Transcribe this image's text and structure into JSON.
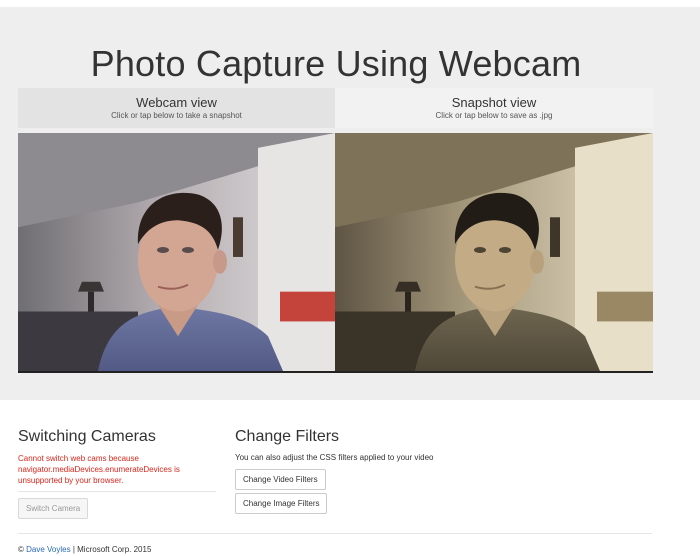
{
  "page": {
    "title": "Photo Capture Using Webcam"
  },
  "webcam": {
    "title": "Webcam view",
    "subtitle": "Click or tap below to take a snapshot"
  },
  "snapshot": {
    "title": "Snapshot view",
    "subtitle": "Click or tap below to save as .jpg"
  },
  "switching": {
    "heading": "Switching Cameras",
    "error": "Cannot switch web cams because navigator.mediaDevices.enumerateDevices is unsupported by your browser.",
    "button_label": "Switch Camera"
  },
  "filters": {
    "heading": "Change Filters",
    "description": "You can also adjust the CSS filters applied to your video",
    "video_button_label": "Change Video Filters",
    "image_button_label": "Change Image Filters"
  },
  "footer": {
    "copyright": "©",
    "author_link": "Dave Voyles",
    "rest": "| Microsoft Corp. 2015"
  },
  "colors": {
    "jumbotron_bg": "#eeeeee",
    "error_text": "#d9261c",
    "link": "#2a6ab8"
  }
}
